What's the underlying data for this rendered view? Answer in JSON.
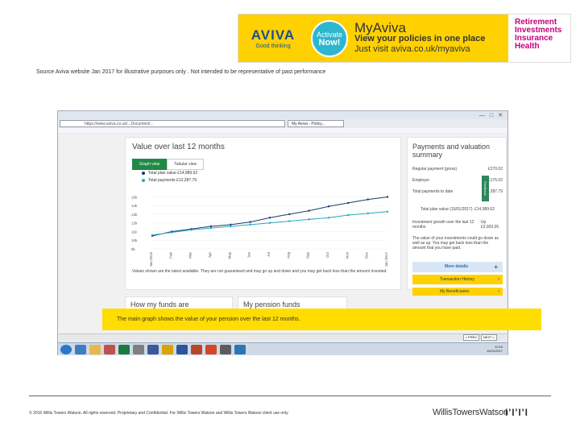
{
  "banner": {
    "logo_word": "AVIVA",
    "logo_tagline": "Good thinking",
    "badge_line1": "Activate",
    "badge_line2": "Now!",
    "title": "MyAviva",
    "line1": "View your policies in one place",
    "line2": "Just visit aviva.co.uk/myaviva",
    "side_items": [
      "Retirement",
      "Investments",
      "Insurance",
      "Health"
    ],
    "colors": {
      "yellow": "#ffd100",
      "blue": "#1d4f91",
      "magenta": "#c6007e",
      "teal": "#2fb6cf"
    }
  },
  "source_note": "Source Aviva website Jan 2017 for illustrative purposes only . Not intended to be representative of past performance",
  "browser": {
    "address": "https://www.aviva.co.uk/...Document/...",
    "tab_label": "My Aviva - Policy...",
    "card_value": {
      "title": "Value over last 12 months",
      "tab_graph": "Graph view",
      "tab_table": "Tabular view",
      "legend_total_value": "Total plan value £14,989.62",
      "legend_total_payments": "Total payments £12,287.79",
      "note": "Values shown are the latest available. They are not guaranteed and may go up and down and you may get back less than the amount invested."
    },
    "card_payments": {
      "title": "Payments and valuation summary",
      "rows": [
        {
          "label": "Regular payment (gross)",
          "value": "£270.02"
        },
        {
          "label": "Employer",
          "value": "£175.02"
        },
        {
          "label": "Total payments to date",
          "value": "£12,287.79"
        },
        {
          "label": "Total plan value (10/01/2017)",
          "value": "£14,989.62"
        },
        {
          "label": "Investment growth over the last 12 months",
          "value": "Up £2,903.05"
        }
      ],
      "disclaimer": "The value of your investments could go down as well as up. You may get back less than the amount that you have paid.",
      "more_details": "More details",
      "btn_transactions": "Transaction History",
      "btn_beneficiaries": "My Beneficiaries",
      "feedback": "Feedback"
    },
    "card_funds_title": "How my funds are",
    "card_pension_title": "My pension funds",
    "tooltip": "The main graph shows the value of your pension over the last 12 months.",
    "prev_label": "< PREV",
    "next_label": "NEXT >",
    "clock_time": "12:50",
    "clock_date": "10/01/2017"
  },
  "chart_data": {
    "type": "line",
    "x": [
      "Jan 2016",
      "Feb",
      "Mar",
      "Apr",
      "May",
      "Jun",
      "Jul",
      "Aug",
      "Sep",
      "Oct",
      "Nov",
      "Dec",
      "Jan 2017"
    ],
    "series": [
      {
        "name": "Total plan value",
        "color": "#1a3a6b",
        "values": [
          10500,
          11000,
          11300,
          11600,
          11800,
          12100,
          12600,
          13000,
          13400,
          13900,
          14300,
          14700,
          14990
        ]
      },
      {
        "name": "Total payments",
        "color": "#2aa6c0",
        "values": [
          10600,
          10900,
          11200,
          11400,
          11600,
          11800,
          12000,
          12200,
          12400,
          12600,
          12900,
          13100,
          13300
        ]
      }
    ],
    "y_ticks": [
      "15k",
      "14k",
      "13k",
      "12k",
      "11k",
      "10k",
      "9k"
    ],
    "ylim": [
      9000,
      15500
    ]
  },
  "footer": {
    "copyright": "© 2016 Willis Towers Watson. All rights reserved. Proprietary and Confidential. For Willis Towers Watson and Willis Towers Watson client use only.",
    "brand": "WillisTowersWatson",
    "brand_mark": "I'I'I'I"
  }
}
